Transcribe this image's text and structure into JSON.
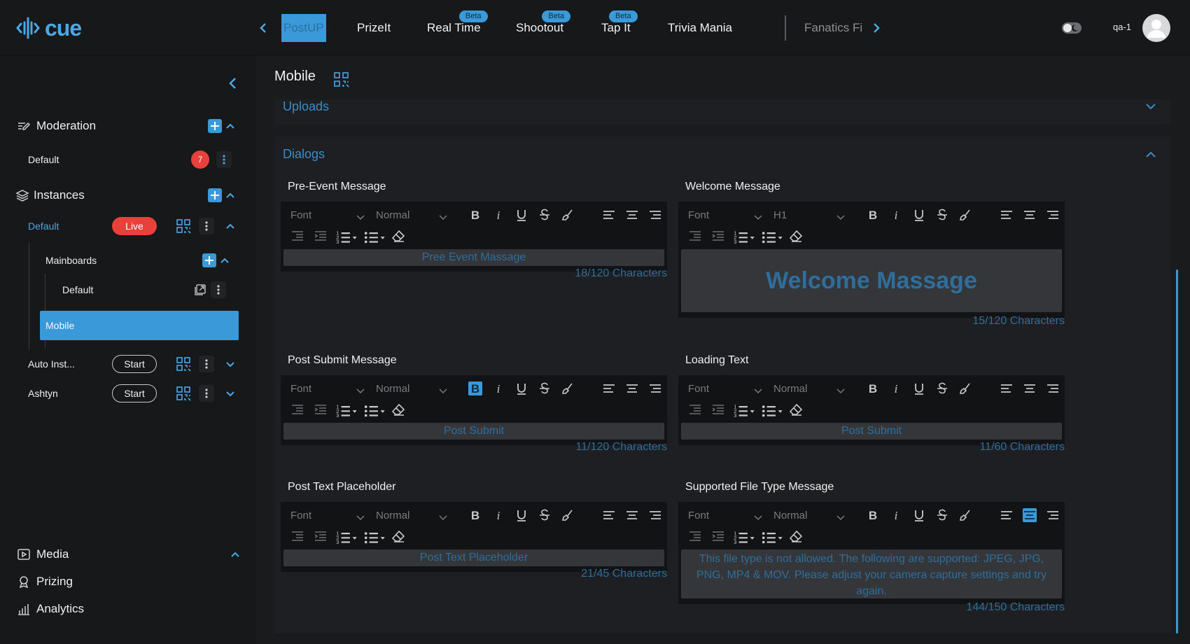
{
  "app": {
    "logo_text": "cue",
    "user": "qa-1"
  },
  "colors": {
    "accent": "#3a9ad9",
    "live": "#e8403a",
    "bg": "#1a1b1d"
  },
  "tabs": [
    {
      "label": "PostUP",
      "active": true
    },
    {
      "label": "PrizeIt"
    },
    {
      "label": "Real Time",
      "badge": "Beta"
    },
    {
      "label": "Shootout",
      "badge": "Beta"
    },
    {
      "label": "Tap It",
      "badge": "Beta"
    },
    {
      "label": "Trivia Mania"
    },
    {
      "label": "Fanatics Fi"
    }
  ],
  "sidebar": {
    "moderation": {
      "label": "Moderation",
      "default_label": "Default",
      "count": "7"
    },
    "instances": {
      "label": "Instances",
      "default_label": "Default",
      "status": "Live"
    },
    "mainboards": {
      "label": "Mainboards",
      "default_label": "Default"
    },
    "mobile_label": "Mobile",
    "auto_inst": {
      "label": "Auto Inst...",
      "action": "Start"
    },
    "ashtyn": {
      "label": "Ashtyn",
      "action": "Start"
    },
    "media_label": "Media",
    "prizing_label": "Prizing",
    "analytics_label": "Analytics"
  },
  "main": {
    "title": "Mobile",
    "uploads_title": "Uploads",
    "dialogs_title": "Dialogs",
    "toolbar": {
      "font": "Font",
      "normal": "Normal",
      "h1": "H1"
    },
    "editors": [
      {
        "label": "Pre-Event Message",
        "value": "Pree Event Massage",
        "count": "18/120 Characters"
      },
      {
        "label": "Welcome Message",
        "value": "Welcome Massage",
        "count": "15/120 Characters"
      },
      {
        "label": "Post Submit Message",
        "value": "Post Submit",
        "count": "11/120 Characters"
      },
      {
        "label": "Loading Text",
        "value": "Post Submit",
        "count": "11/60 Characters"
      },
      {
        "label": "Post Text Placeholder",
        "value": "Post Text Placeholder",
        "count": "21/45 Characters"
      },
      {
        "label": "Supported File Type Message",
        "value": "This file type is not allowed. The following are supported: JPEG, JPG, PNG, MP4 & MOV. Please adjust your camera capture settings and try again.",
        "count": "144/150 Characters"
      }
    ]
  }
}
